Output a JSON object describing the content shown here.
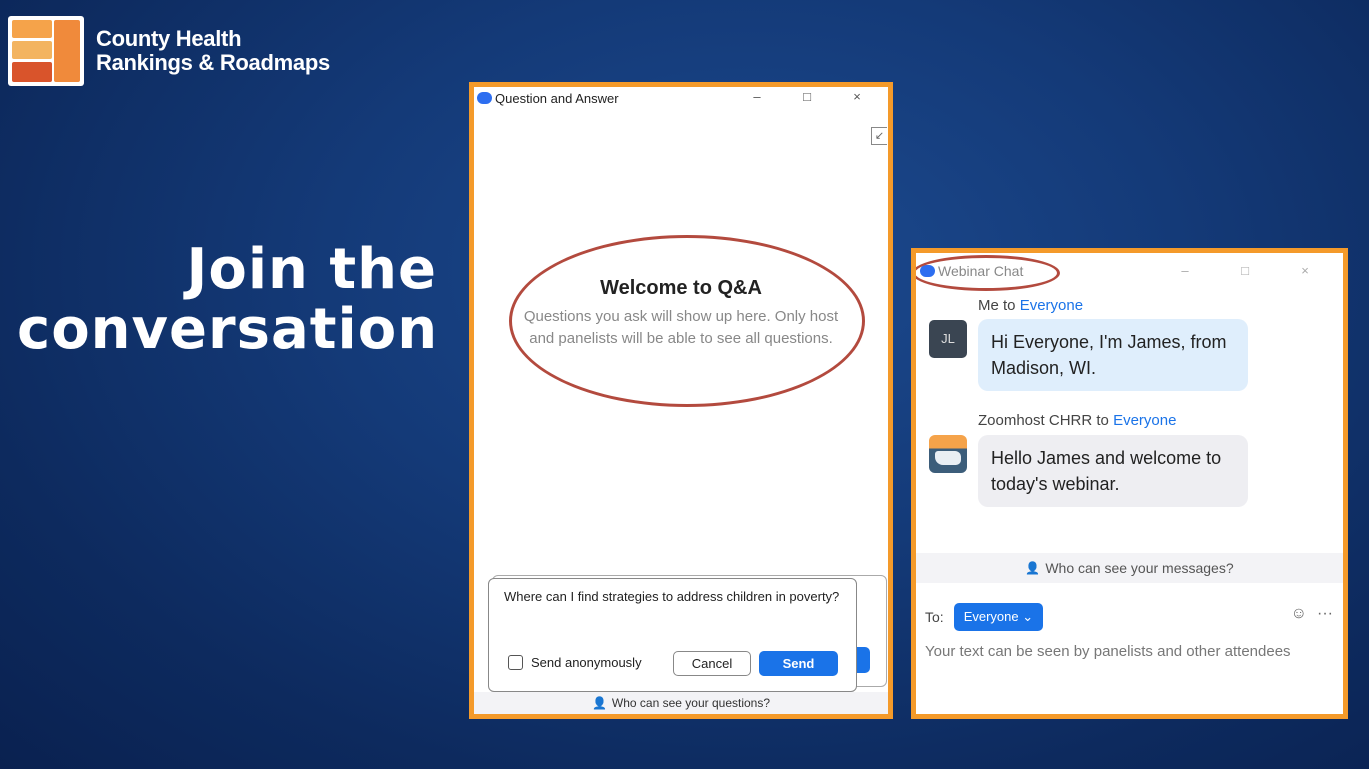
{
  "logo": {
    "line1": "County Health",
    "line2": "Rankings & Roadmaps"
  },
  "headline": {
    "line1": "Join the",
    "line2": "conversation"
  },
  "qa_window": {
    "title": "Question and Answer",
    "controls": [
      "–",
      "□",
      "×"
    ],
    "welcome_title": "Welcome to Q&A",
    "welcome_text": "Questions you ask will show up here. Only host and panelists will be able to see all questions.",
    "question_value": "Where can I find strategies to address children in poverty?",
    "anonymous_label": "Send anonymously",
    "cancel_label": "Cancel",
    "send_label": "Send",
    "footer_text": "Who can see your questions?"
  },
  "chat_window": {
    "title": "Webinar Chat",
    "controls": [
      "–",
      "□",
      "×"
    ],
    "messages": [
      {
        "sender": "Me",
        "to_word": "to",
        "recipient": "Everyone",
        "avatar": "JL",
        "text": "Hi Everyone, I'm James, from Madison, WI."
      },
      {
        "sender": "Zoomhost CHRR",
        "to_word": "to",
        "recipient": "Everyone",
        "text": "Hello James and welcome to today's webinar."
      }
    ],
    "who_text": "Who can see your messages?",
    "to_label": "To:",
    "recipient_button": "Everyone ⌄",
    "placeholder": "Your text can be seen by panelists and other attendees"
  },
  "colors": {
    "highlight_border": "#f49a2a",
    "annotation_ellipse": "#b34a3e",
    "accent": "#1a73e8"
  },
  "icons": [
    "zoom-logo-icon",
    "popout-icon",
    "person-icon",
    "emoji-icon",
    "more-icon"
  ]
}
